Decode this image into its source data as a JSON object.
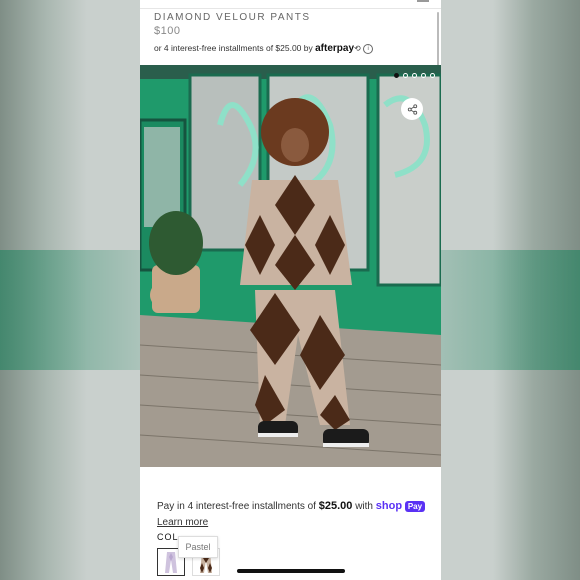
{
  "product": {
    "title": "DIAMOND VELOUR PANTS",
    "price": "$100",
    "afterpay_text": "or 4 interest-free installments of $25.00 by",
    "afterpay_brand": "afterpay"
  },
  "gallery": {
    "dots": [
      true,
      false,
      false,
      false,
      false
    ],
    "share_icon": "share-icon"
  },
  "shoppay": {
    "text": "Pay in 4 interest-free installments of",
    "amount": "$25.00",
    "with": "with",
    "shop": "shop",
    "pay": "Pay",
    "learn_more": "Learn more"
  },
  "color": {
    "label": "COL",
    "tooltip": "Pastel"
  },
  "colors": {
    "accent": "#5a31f4",
    "wall_green": "#1f9a6b"
  }
}
